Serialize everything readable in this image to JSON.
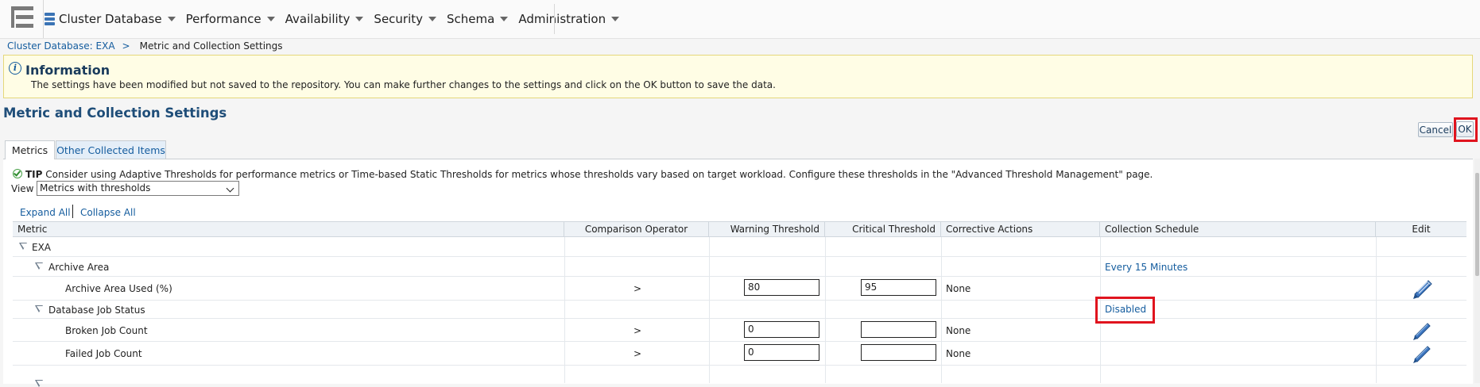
{
  "nav": {
    "items": [
      {
        "label": "Cluster Database",
        "icon": "database-icon"
      },
      {
        "label": "Performance"
      },
      {
        "label": "Availability"
      },
      {
        "label": "Security"
      },
      {
        "label": "Schema"
      },
      {
        "label": "Administration"
      }
    ]
  },
  "breadcrumb": {
    "parent": "Cluster Database: EXA",
    "separator": ">",
    "current": "Metric and Collection Settings"
  },
  "info": {
    "title": "Information",
    "message": "The settings have been modified but not saved to the repository. You can make further changes to the settings and click on the OK button to save the data."
  },
  "page": {
    "title": "Metric and Collection Settings"
  },
  "buttons": {
    "cancel": "Cancel",
    "ok": "OK"
  },
  "tabs": {
    "metrics": "Metrics",
    "other": "Other Collected Items"
  },
  "tip": {
    "prefix": "TIP",
    "text": "Consider using Adaptive Thresholds for performance metrics or Time-based Static Thresholds for metrics whose thresholds vary based on target workload. Configure these thresholds in the \"Advanced Threshold Management\" page."
  },
  "view": {
    "label": "View",
    "selected": "Metrics with thresholds"
  },
  "tree_controls": {
    "expand_all": "Expand All",
    "collapse_all": "Collapse All"
  },
  "table": {
    "headers": {
      "metric": "Metric",
      "operator": "Comparison Operator",
      "warning": "Warning Threshold",
      "critical": "Critical Threshold",
      "actions": "Corrective Actions",
      "schedule": "Collection Schedule",
      "edit": "Edit"
    },
    "rows": {
      "exa": {
        "metric": "EXA"
      },
      "archive_area": {
        "metric": "Archive Area",
        "schedule": "Every 15 Minutes"
      },
      "archive_used": {
        "metric": "Archive Area Used (%)",
        "operator": ">",
        "warning": "80",
        "critical": "95",
        "actions": "None"
      },
      "job_status": {
        "metric": "Database Job Status",
        "schedule": "Disabled"
      },
      "broken_job": {
        "metric": "Broken Job Count",
        "operator": ">",
        "warning": "0",
        "critical": "",
        "actions": "None"
      },
      "failed_job": {
        "metric": "Failed Job Count",
        "operator": ">",
        "warning": "0",
        "critical": "",
        "actions": "None"
      }
    }
  },
  "colors": {
    "link": "#145c9e",
    "highlight": "#e0141e",
    "banner_bg": "#fffde5",
    "title": "#1f4e79"
  }
}
